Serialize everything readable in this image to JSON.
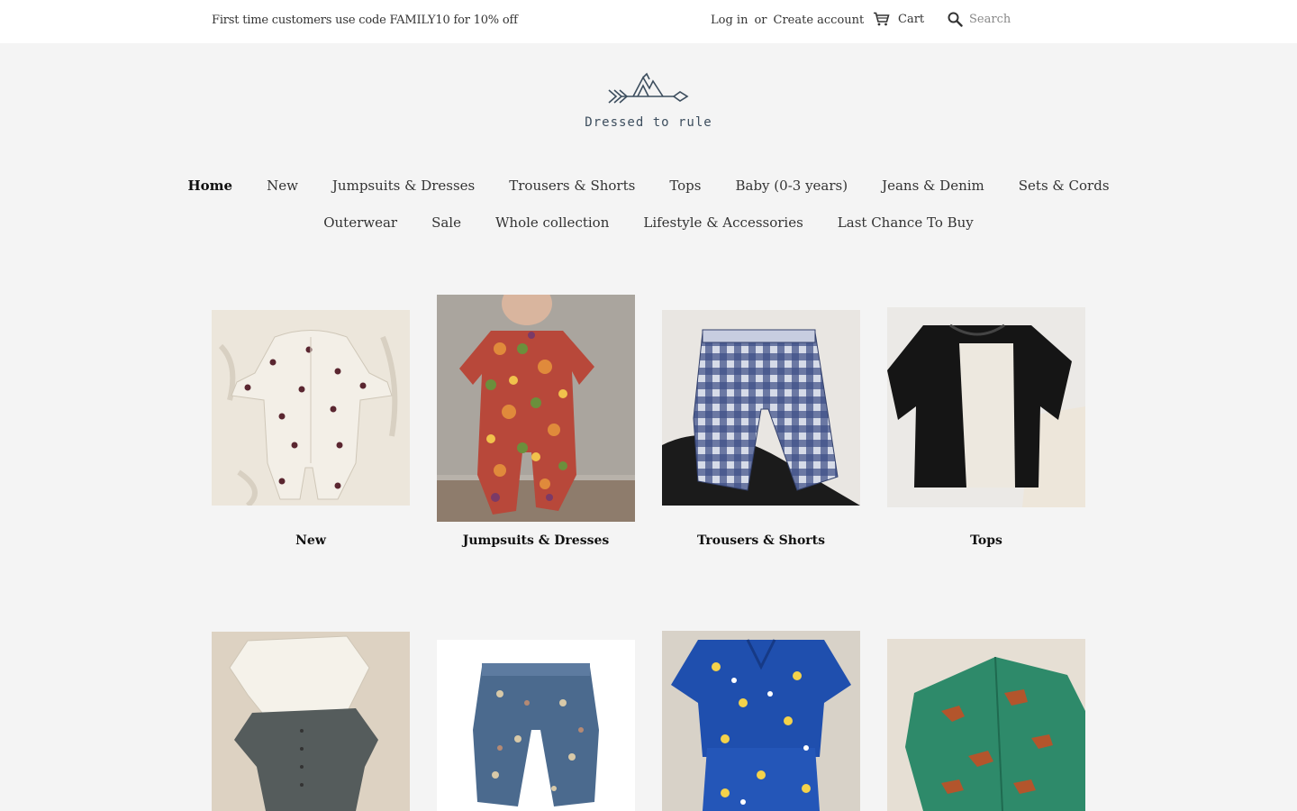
{
  "topbar": {
    "promo": "First time customers use code FAMILY10 for 10% off",
    "login": "Log in",
    "or": "or",
    "create_account": "Create account",
    "cart": "Cart",
    "search_placeholder": "Search"
  },
  "logo": {
    "text": "Dressed to rule",
    "color": "#3d4e5e"
  },
  "nav": {
    "row1": [
      "Home",
      "New",
      "Jumpsuits & Dresses",
      "Trousers & Shorts",
      "Tops",
      "Baby (0-3 years)",
      "Jeans & Denim",
      "Sets & Cords"
    ],
    "row2": [
      "Outerwear",
      "Sale",
      "Whole collection",
      "Lifestyle & Accessories",
      "Last Chance To Buy"
    ],
    "active": "Home"
  },
  "collections": [
    {
      "title": "New",
      "image": "cream fleece jumpsuit with moon prints on fur rug"
    },
    {
      "title": "Jumpsuits & Dresses",
      "image": "child in floral print jumpsuit"
    },
    {
      "title": "Trousers & Shorts",
      "image": "blue gingham check trousers"
    },
    {
      "title": "Tops",
      "image": "black and cream colour-block top"
    },
    {
      "title": "",
      "image": "quilted cream jacket and grey jumpsuit on fur rug"
    },
    {
      "title": "",
      "image": "floral denim trousers"
    },
    {
      "title": "",
      "image": "blue sunflower print shirt and shorts set"
    },
    {
      "title": "",
      "image": "green fleece jacket with rust pattern"
    }
  ]
}
